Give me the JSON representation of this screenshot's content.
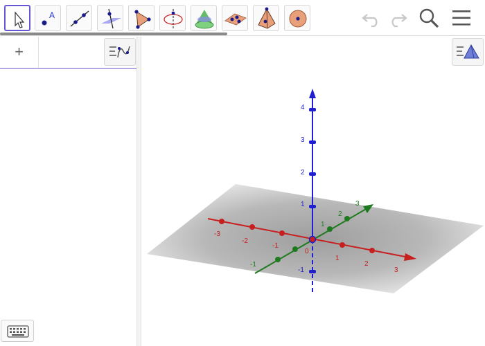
{
  "toolbar": {
    "tools": [
      {
        "name": "move",
        "icon": "move-arrow-icon",
        "selected": true
      },
      {
        "name": "point",
        "icon": "point-icon",
        "label": "A"
      },
      {
        "name": "line",
        "icon": "line-icon"
      },
      {
        "name": "perpendicular-line",
        "icon": "perpendicular-line-icon"
      },
      {
        "name": "polygon",
        "icon": "polygon-icon"
      },
      {
        "name": "circle-axis",
        "icon": "circle-axis-icon"
      },
      {
        "name": "intersect-surfaces",
        "icon": "cone-icon"
      },
      {
        "name": "plane",
        "icon": "plane-icon"
      },
      {
        "name": "pyramid",
        "icon": "pyramid-icon"
      },
      {
        "name": "sphere",
        "icon": "sphere-icon"
      }
    ],
    "right": [
      {
        "name": "undo",
        "icon": "undo-icon"
      },
      {
        "name": "redo",
        "icon": "redo-icon"
      },
      {
        "name": "search",
        "icon": "search-icon"
      },
      {
        "name": "menu",
        "icon": "hamburger-menu-icon"
      }
    ]
  },
  "algebra": {
    "add_label": "+",
    "style_icon": "algebra-style-icon"
  },
  "graphics3d": {
    "style_icon": "graphics-style-icon",
    "axes": {
      "z": {
        "ticks": [
          "-1",
          "1",
          "2",
          "3",
          "4"
        ],
        "color": "#1f1fcf"
      },
      "x": {
        "ticks": [
          "-3",
          "-2",
          "-1",
          "1",
          "2",
          "3"
        ],
        "color": "#c81e1e"
      },
      "y": {
        "ticks": [
          "-1",
          "1",
          "2",
          "3"
        ],
        "color": "#1e7a1e"
      },
      "origin_label": "0"
    },
    "plane_color": "#b3b3b3"
  },
  "keyboard": {
    "icon": "keyboard-icon"
  },
  "colors": {
    "accent": "#6557d2"
  }
}
